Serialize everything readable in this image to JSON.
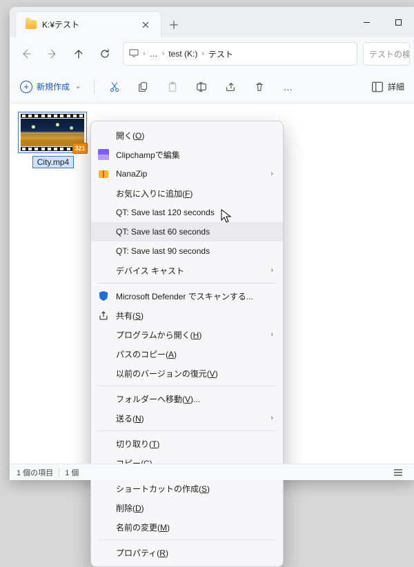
{
  "tab": {
    "title": "K:¥テスト"
  },
  "address": {
    "overflow": "…",
    "crumbs": [
      "test (K:)",
      "テスト"
    ]
  },
  "search": {
    "placeholder": "テストの検"
  },
  "toolbar": {
    "new_label": "新規作成",
    "more": "…",
    "details_label": "詳細"
  },
  "file": {
    "name": "City.mp4",
    "badge": "321"
  },
  "status": {
    "items": "1 個の項目",
    "selected": "1 個"
  },
  "menu": {
    "open": "開く(",
    "open_k": "O",
    "open_suf": ")",
    "clipchamp": "Clipchampで編集",
    "nanazip": "NanaZip",
    "fav": "お気に入りに追加(",
    "fav_k": "F",
    "fav_suf": ")",
    "qt120": "QT: Save last 120 seconds",
    "qt60": "QT: Save last 60 seconds",
    "qt90": "QT: Save last 90 seconds",
    "cast": "デバイス キャスト",
    "defender": "Microsoft Defender でスキャンする...",
    "share": "共有(",
    "share_k": "S",
    "share_suf": ")",
    "openwith": "プログラムから開く(",
    "openwith_k": "H",
    "openwith_suf": ")",
    "copypath": "パスのコピー(",
    "copypath_k": "A",
    "copypath_suf": ")",
    "restore": "以前のバージョンの復元(",
    "restore_k": "V",
    "restore_suf": ")",
    "moveto": "フォルダーへ移動(",
    "moveto_k": "V",
    "moveto_suf": ")...",
    "sendto": "送る(",
    "sendto_k": "N",
    "sendto_suf": ")",
    "cut": "切り取り(",
    "cut_k": "T",
    "cut_suf": ")",
    "copy": "コピー(",
    "copy_k": "C",
    "copy_suf": ")",
    "shortcut": "ショートカットの作成(",
    "shortcut_k": "S",
    "shortcut_suf": ")",
    "delete": "削除(",
    "delete_k": "D",
    "delete_suf": ")",
    "rename": "名前の変更(",
    "rename_k": "M",
    "rename_suf": ")",
    "props": "プロパティ(",
    "props_k": "R",
    "props_suf": ")"
  }
}
